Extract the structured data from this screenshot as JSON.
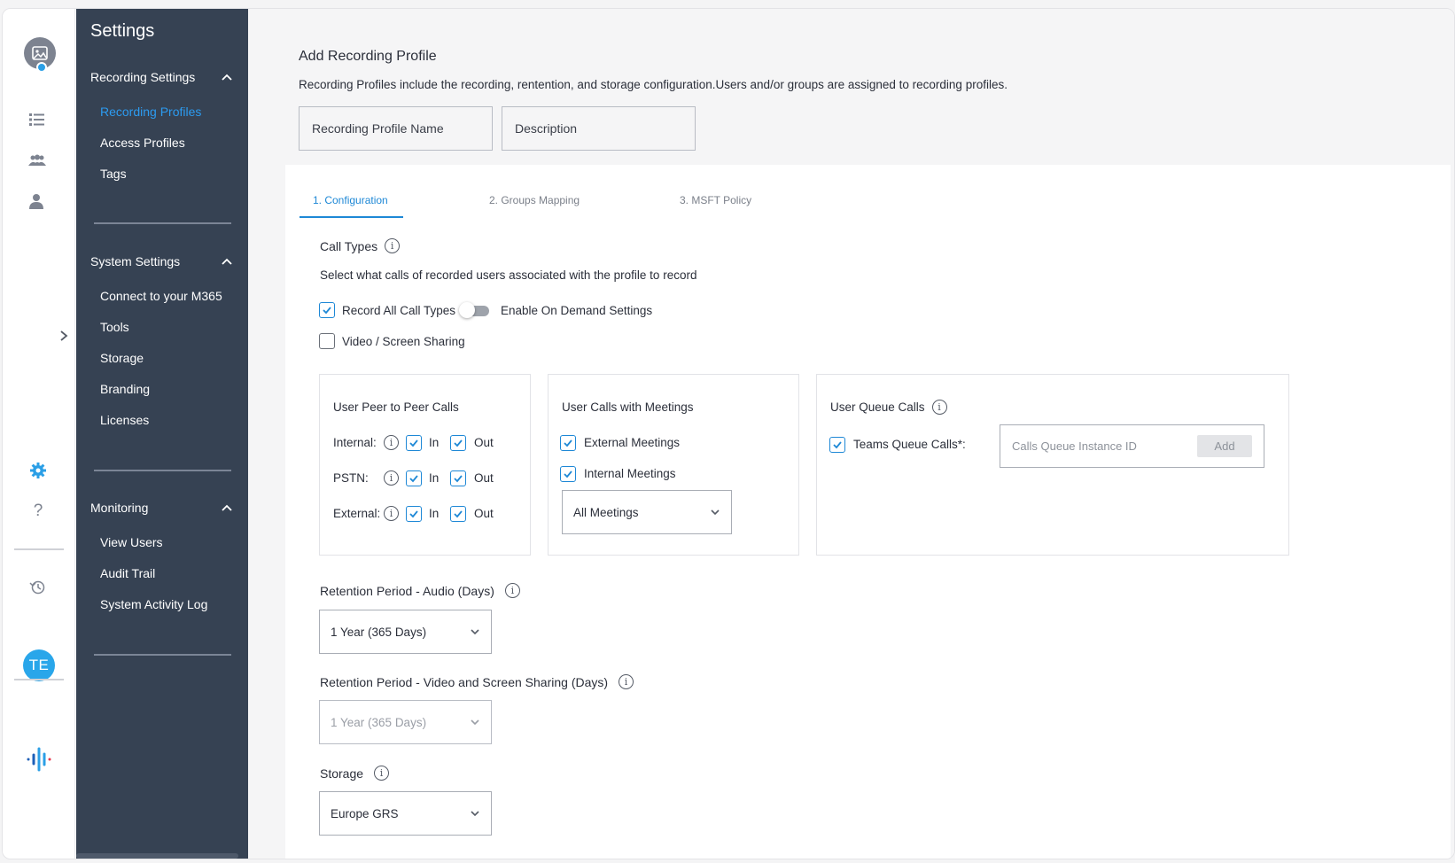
{
  "rail": {
    "icons": [
      "profile-image-icon",
      "list-icon",
      "group-icon",
      "person-icon",
      "expand-chevron-icon",
      "gear-icon",
      "help-icon",
      "history-icon",
      "app-logo-icon"
    ],
    "user_initials": "TE",
    "accent_color": "#29a6ea"
  },
  "menu": {
    "title": "Settings",
    "sections": [
      {
        "heading": "Recording Settings",
        "items": [
          "Recording Profiles",
          "Access Profiles",
          "Tags"
        ]
      },
      {
        "heading": "System Settings",
        "items": [
          "Connect to your M365",
          "Tools",
          "Storage",
          "Branding",
          "Licenses"
        ]
      },
      {
        "heading": "Monitoring",
        "items": [
          "View Users",
          "Audit Trail",
          "System Activity Log"
        ]
      }
    ],
    "active_item": "Recording Profiles",
    "background_color": "#364253",
    "active_color": "#2c9bf0"
  },
  "page": {
    "title": "Add Recording Profile",
    "description": "Recording Profiles include the recording, rentention, and storage configuration.Users and/or groups are assigned to recording profiles.",
    "name_placeholder": "Recording Profile Name",
    "description_placeholder": "Description"
  },
  "tabs": [
    "1. Configuration",
    "2. Groups Mapping",
    "3. MSFT Policy"
  ],
  "active_tab": "1. Configuration",
  "call_types": {
    "heading": "Call Types",
    "help": "Select what calls of recorded users associated with the profile to record",
    "record_all_label": "Record All Call Types",
    "record_all_checked": true,
    "on_demand_label": "Enable On Demand Settings",
    "on_demand_enabled": false,
    "video_label": "Video / Screen Sharing",
    "video_checked": false
  },
  "peer_calls": {
    "heading": "User Peer to Peer Calls",
    "rows": [
      {
        "label": "Internal:",
        "in": "In",
        "out": "Out"
      },
      {
        "label": "PSTN:",
        "in": "In",
        "out": "Out"
      },
      {
        "label": "External:",
        "in": "In",
        "out": "Out"
      }
    ]
  },
  "meeting_calls": {
    "heading": "User Calls with Meetings",
    "external_label": "External Meetings",
    "internal_label": "Internal Meetings",
    "select_value": "All Meetings"
  },
  "queue_calls": {
    "heading": "User Queue Calls",
    "teams_label": "Teams Queue Calls*:",
    "input_placeholder": "Calls Queue Instance ID",
    "add_label": "Add"
  },
  "retention_audio": {
    "heading": "Retention Period - Audio (Days)",
    "value": "1 Year (365 Days)"
  },
  "retention_video": {
    "heading": "Retention Period - Video and Screen Sharing (Days)",
    "value": "1 Year (365 Days)"
  },
  "storage": {
    "heading": "Storage",
    "value": "Europe GRS"
  },
  "colors": {
    "primary": "#1e88d6",
    "page_bg": "#f5f5f6"
  }
}
